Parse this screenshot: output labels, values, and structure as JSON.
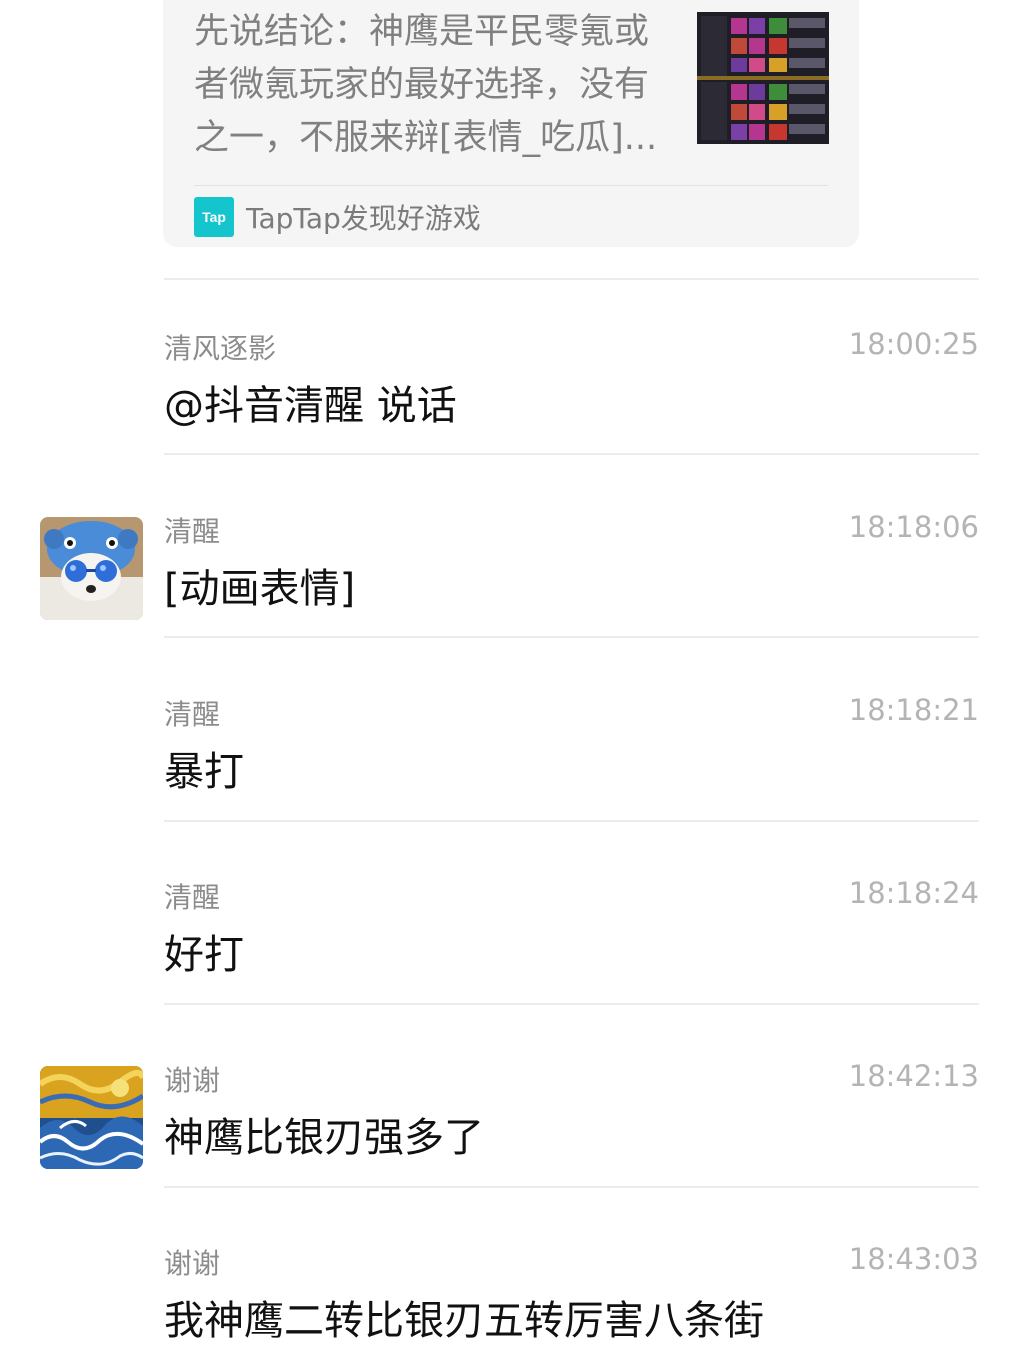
{
  "shared_card": {
    "text": "先说结论：神鹰是平民零氪或者微氪玩家的最好选择，没有之一，不服来辩[表情_吃瓜]...",
    "logo_text": "Tap",
    "source": "TapTap发现好游戏",
    "logo_color": "#15c5ce"
  },
  "messages": [
    {
      "sender": "清风逐影",
      "time": "18:00:25",
      "text": "@抖音清醒 说话",
      "avatar": null
    },
    {
      "sender": "清醒",
      "time": "18:18:06",
      "text": "[动画表情]",
      "avatar": "blue-hat-dog-avatar"
    },
    {
      "sender": "清醒",
      "time": "18:18:21",
      "text": "暴打",
      "avatar": null
    },
    {
      "sender": "清醒",
      "time": "18:18:24",
      "text": "好打",
      "avatar": null
    },
    {
      "sender": "谢谢",
      "time": "18:42:13",
      "text": "神鹰比银刃强多了",
      "avatar": "starry-wave-painting-avatar"
    },
    {
      "sender": "谢谢",
      "time": "18:43:03",
      "text": "我神鹰二转比银刃五转厉害八条街",
      "avatar": null
    }
  ]
}
